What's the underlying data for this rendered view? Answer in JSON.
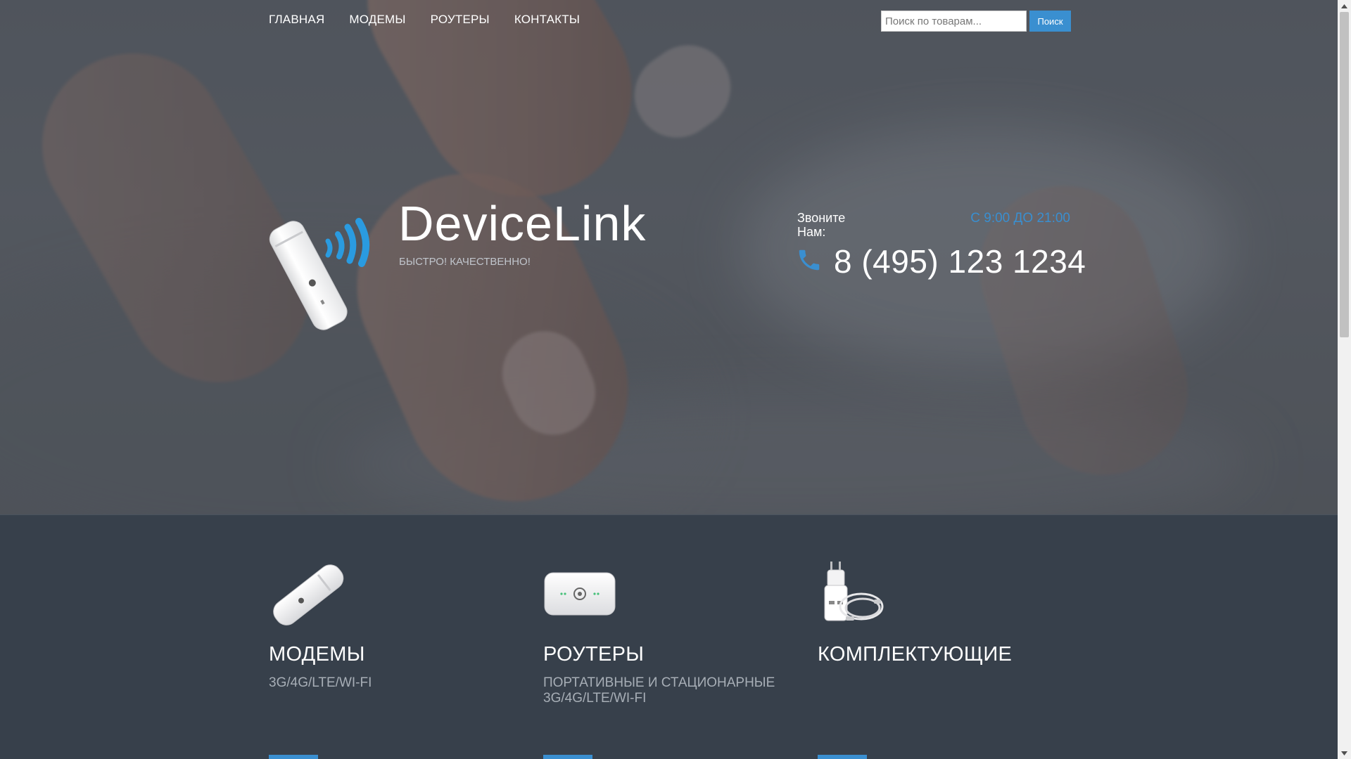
{
  "nav": {
    "items": [
      {
        "label": "ГЛАВНАЯ"
      },
      {
        "label": "МОДЕМЫ"
      },
      {
        "label": "РОУТЕРЫ"
      },
      {
        "label": "КОНТАКТЫ"
      }
    ]
  },
  "search": {
    "placeholder": "Поиск по товарам...",
    "value": "",
    "button_label": "Поиск"
  },
  "brand": {
    "name": "DeviceLink",
    "tagline": "БЫСТРО! КАЧЕСТВЕННО!"
  },
  "contact": {
    "call_label": "Звоните Нам:",
    "hours": "С 9:00 ДО 21:00",
    "phone": "8 (495) 123 1234"
  },
  "categories": [
    {
      "title": "МОДЕМЫ",
      "subtitle": "3G/4G/LTE/WI-FI",
      "icon": "usb-modem-image"
    },
    {
      "title": "РОУТЕРЫ",
      "subtitle": "ПОРТАТИВНЫЕ И СТАЦИОНАРНЫЕ 3G/4G/LTE/WI-FI",
      "icon": "pocket-router-image"
    },
    {
      "title": "КОМПЛЕКТУЮЩИЕ",
      "subtitle": "",
      "icon": "charger-cable-image"
    }
  ],
  "colors": {
    "accent": "#3a8fd0",
    "hero_overlay": "#5b6068",
    "section_background": "#37404b",
    "muted_text": "#a7aeb6"
  }
}
